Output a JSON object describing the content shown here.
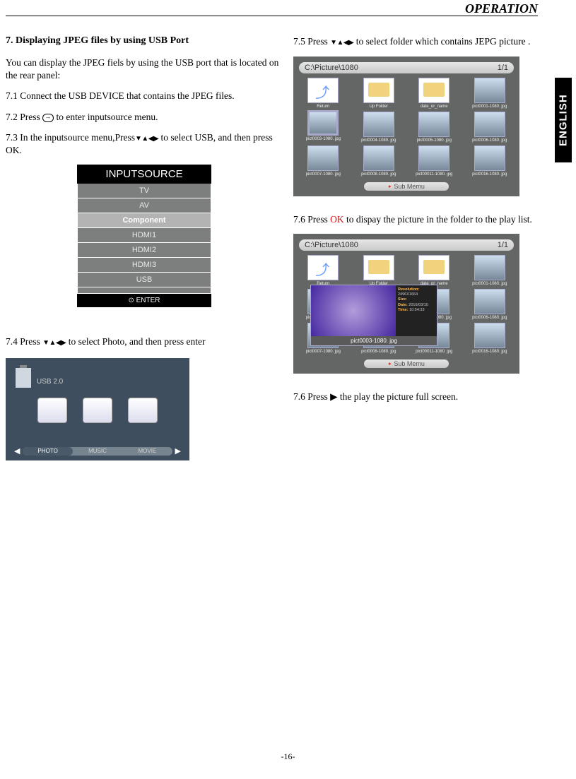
{
  "header": {
    "title": "OPERATION",
    "side_tab": "ENGLISH",
    "page_number": "-16-"
  },
  "left": {
    "title": "7.  Displaying JPEG files by using USB Port",
    "intro": "You can display the JPEG fiels by using the USB port that is located on the rear panel:",
    "s71": "7.1  Connect the USB DEVICE that contains the JPEG files.",
    "s72_a": "7.2  Press",
    "s72_b": " to enter inputsource menu.",
    "s73_a": "7.3  In the inputsource menu,Press",
    "s73_b": " to select USB, and then press OK.",
    "s74_a": "7.4 Press ",
    "s74_b": " to select Photo, and then press enter"
  },
  "inputsource": {
    "title": "INPUTSOURCE",
    "items": [
      "TV",
      "AV",
      "Component",
      "HDMI1",
      "HDMI2",
      "HDMI3",
      "USB",
      ""
    ],
    "selected": "Component",
    "footer": "⊙ ENTER"
  },
  "media": {
    "usb_label": "USB 2.0",
    "tabs": [
      "PHOTO",
      "MUSIC",
      "MOVIE"
    ],
    "active_tab": "PHOTO"
  },
  "right": {
    "s75_a": "7.5  Press ",
    "s75_b": " to select folder which contains  JEPG picture .",
    "s76_a": "7.6  Press ",
    "s76_ok": "OK",
    "s76_b": " to dispay the picture in the folder to the play list.",
    "s76c_a": "7.6  Press ",
    "s76c_sym": "▶",
    "s76c_b": " the play the picture full screen."
  },
  "browser": {
    "path": "C:\\Picture\\1080",
    "page": "1/1",
    "submenu": "Sub Memu",
    "rows": [
      [
        {
          "kind": "return",
          "label": "Return"
        },
        {
          "kind": "folder",
          "label": "Up Folder"
        },
        {
          "kind": "folder",
          "label": "date_or_name"
        },
        {
          "kind": "img",
          "label": "pict0001-1080. jpg"
        }
      ],
      [
        {
          "kind": "img",
          "label": "pict0003-1080. jpg",
          "sel": true
        },
        {
          "kind": "img",
          "label": "pict0004-1080. jpg"
        },
        {
          "kind": "img",
          "label": "pict0005-1080. jpg"
        },
        {
          "kind": "img",
          "label": "pict0006-1080. jpg"
        }
      ],
      [
        {
          "kind": "img",
          "label": "pict0007-1080. jpg"
        },
        {
          "kind": "img",
          "label": "pict0008-1080. jpg"
        },
        {
          "kind": "img",
          "label": "pict00011-1080. jpg"
        },
        {
          "kind": "img",
          "label": "pict0016-1080. jpg"
        }
      ]
    ]
  },
  "preview": {
    "caption": "pict0003-1080. jpg",
    "meta": {
      "res_l": "Resolution:",
      "res_v": "2496X1664",
      "size_l": "Size:",
      "size_v": "",
      "date_l": "Date:",
      "date_v": "2016/03/10",
      "time_l": "Time:",
      "time_v": "10:54:33"
    }
  }
}
